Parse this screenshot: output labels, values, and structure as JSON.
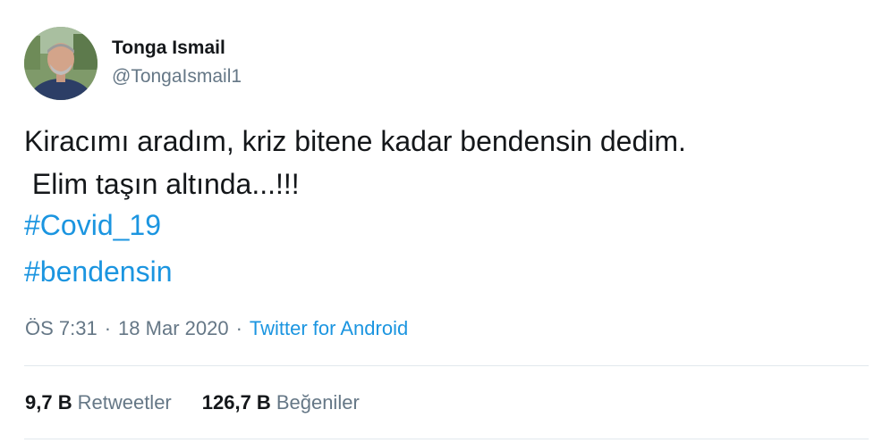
{
  "tweet": {
    "author": {
      "display_name": "Tonga Ismail",
      "username": "@TongaIsmail1",
      "avatar_icon": "profile-photo"
    },
    "text_lines": [
      "Kiracımı aradım, kriz bitene kadar bendensin dedim.",
      " Elim taşın altında...!!!"
    ],
    "hashtags": [
      "#Covid_19",
      "#bendensin"
    ],
    "meta": {
      "time": "ÖS 7:31",
      "separator": "·",
      "date": "18 Mar 2020",
      "source": "Twitter for Android"
    },
    "stats": {
      "retweets_count": "9,7 B",
      "retweets_label": "Retweetler",
      "likes_count": "126,7 B",
      "likes_label": "Beğeniler"
    },
    "colors": {
      "link": "#1b95e0",
      "secondary_text": "#657786",
      "primary_text": "#14171a",
      "divider": "#e1e8ed"
    }
  }
}
